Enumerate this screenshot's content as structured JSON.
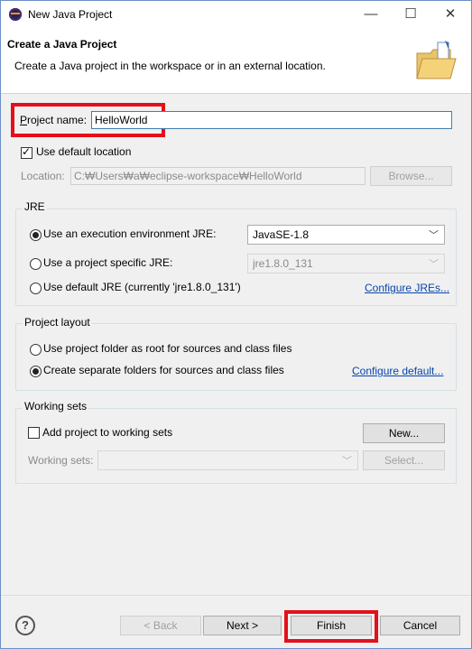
{
  "window": {
    "title": "New Java Project",
    "controls": {
      "minimize": "—",
      "maximize": "☐",
      "close": "✕"
    }
  },
  "header": {
    "title": "Create a Java Project",
    "description": "Create a Java project in the workspace or in an external location."
  },
  "project": {
    "name_label": "Project name:",
    "name_value": "HelloWorld",
    "use_default_location_label": "Use default location",
    "use_default_location_checked": true,
    "location_label": "Location:",
    "location_value": "C:₩Users₩a₩eclipse-workspace₩HelloWorld",
    "browse_label": "Browse..."
  },
  "jre": {
    "group_title": "JRE",
    "option_execution_env": "Use an execution environment JRE:",
    "execution_env_value": "JavaSE-1.8",
    "option_project_specific": "Use a project specific JRE:",
    "project_specific_value": "jre1.8.0_131",
    "option_default": "Use default JRE (currently 'jre1.8.0_131')",
    "configure_link": "Configure JREs..."
  },
  "layout": {
    "group_title": "Project layout",
    "option_root": "Use project folder as root for sources and class files",
    "option_separate": "Create separate folders for sources and class files",
    "configure_link": "Configure default..."
  },
  "working_sets": {
    "group_title": "Working sets",
    "add_label": "Add project to working sets",
    "new_button": "New...",
    "sets_label": "Working sets:",
    "select_button": "Select..."
  },
  "footer": {
    "help": "?",
    "back": "< Back",
    "next": "Next >",
    "finish": "Finish",
    "cancel": "Cancel"
  },
  "colors": {
    "highlight": "#e3101b",
    "link": "#0645ad",
    "dialog_bg": "#f0f0f0"
  },
  "icons": [
    "eclipse-app-icon",
    "open-folder-icon",
    "help-icon",
    "dropdown-arrow-icon"
  ]
}
